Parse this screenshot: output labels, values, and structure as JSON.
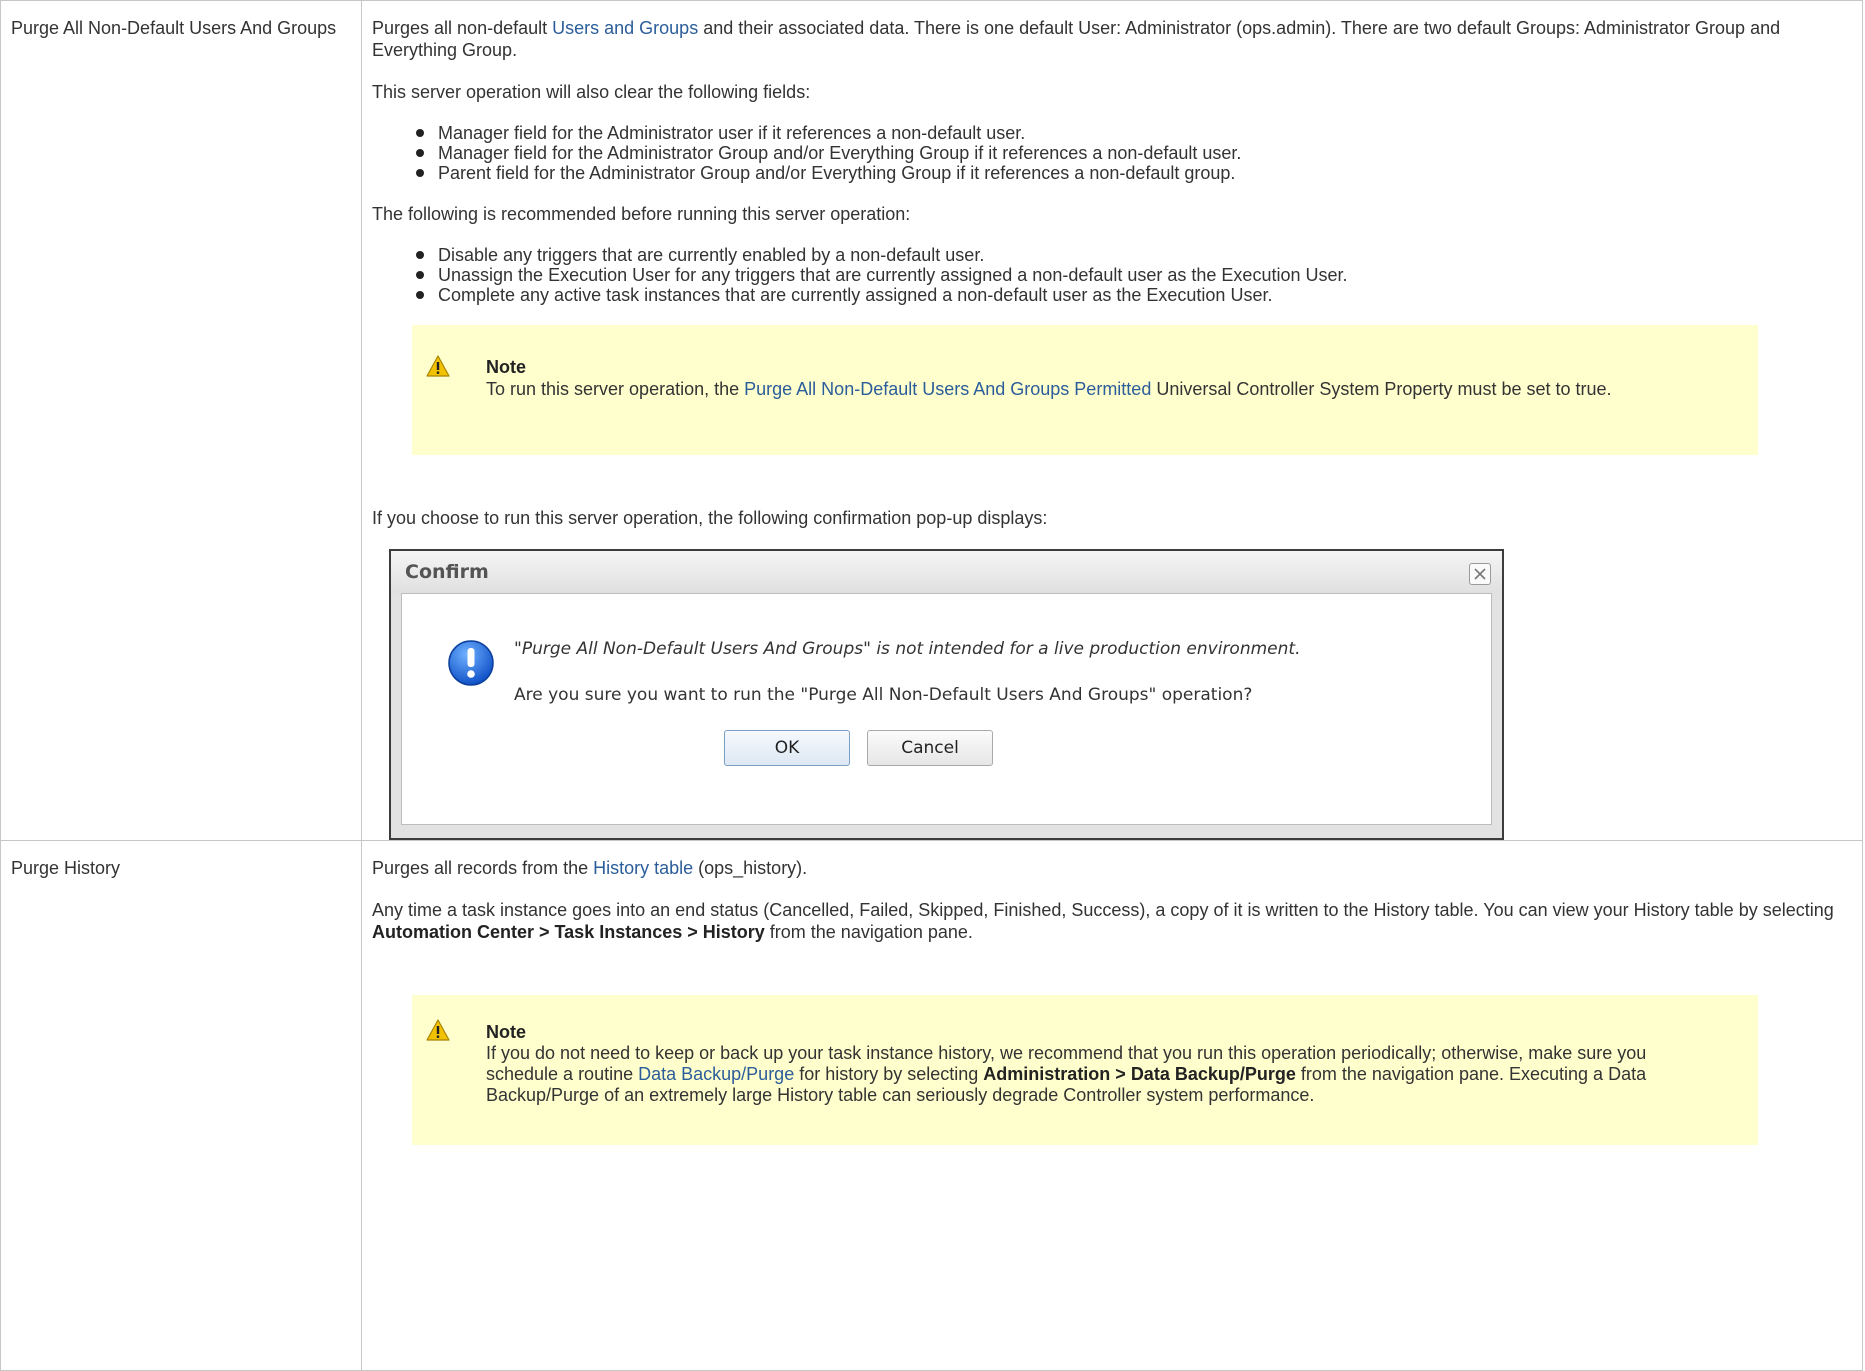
{
  "rows": [
    {
      "name": "Purge All Non-Default Users And Groups",
      "desc": {
        "p1_pre": "Purges all non-default ",
        "p1_link": "Users and Groups",
        "p1_post": " and their associated data. There is one default User: Administrator (ops.admin). There are two default Groups: Administrator Group and Everything Group.",
        "p2": "This server operation will also clear the following fields:",
        "list1": [
          "Manager field for the Administrator user if it references a non-default user.",
          "Manager field for the Administrator Group and/or Everything Group if it references a non-default user.",
          "Parent field for the Administrator Group and/or Everything Group if it references a non-default group."
        ],
        "p3": "The following is recommended before running this server operation:",
        "list2": [
          "Disable any triggers that are currently enabled by a non-default user.",
          "Unassign the Execution User for any triggers that are currently assigned a non-default user as the Execution User.",
          "Complete any active task instances that are currently assigned a non-default user as the Execution User."
        ],
        "note": {
          "title": "Note",
          "pre": "To run this server operation, the ",
          "link": "Purge All Non-Default Users And Groups Permitted",
          "post": " Universal Controller System Property must be set to true."
        },
        "p4": "If you choose to run this server operation, the following confirmation pop-up displays:",
        "dialog": {
          "title": "Confirm",
          "message": "\"Purge All Non-Default Users And Groups\" is not intended for a live production environment.",
          "question": "Are you sure you want to run the \"Purge All Non-Default Users And Groups\" operation?",
          "ok": "OK",
          "cancel": "Cancel"
        }
      }
    },
    {
      "name": "Purge History",
      "desc": {
        "p1_pre": "Purges all records from the ",
        "p1_link": "History table",
        "p1_post": " (ops_history).",
        "p2_pre": "Any time a task instance goes into an end status (Cancelled, Failed, Skipped, Finished, Success), a copy of it is written to the History table. You can view your History table by selecting ",
        "p2_bold": "Automation Center > Task Instances > History",
        "p2_post": " from the navigation pane.",
        "note": {
          "title": "Note",
          "pre": "If you do not need to keep or back up your task instance history, we recommend that you run this operation periodically; otherwise, make sure you schedule a routine ",
          "link": "Data Backup/Purge",
          "mid": " for history by selecting ",
          "bold": "Administration > Data Backup/Purge",
          "post": " from the navigation pane. Executing a Data Backup/Purge of an extremely large History table can seriously degrade Controller system performance."
        }
      }
    }
  ],
  "colors": {
    "link": "#2b5d9a",
    "note_bg": "#ffffce",
    "border": "#c7c7c7"
  },
  "icons": {
    "warning": "warning-icon",
    "info": "info-icon",
    "close": "close-icon"
  }
}
